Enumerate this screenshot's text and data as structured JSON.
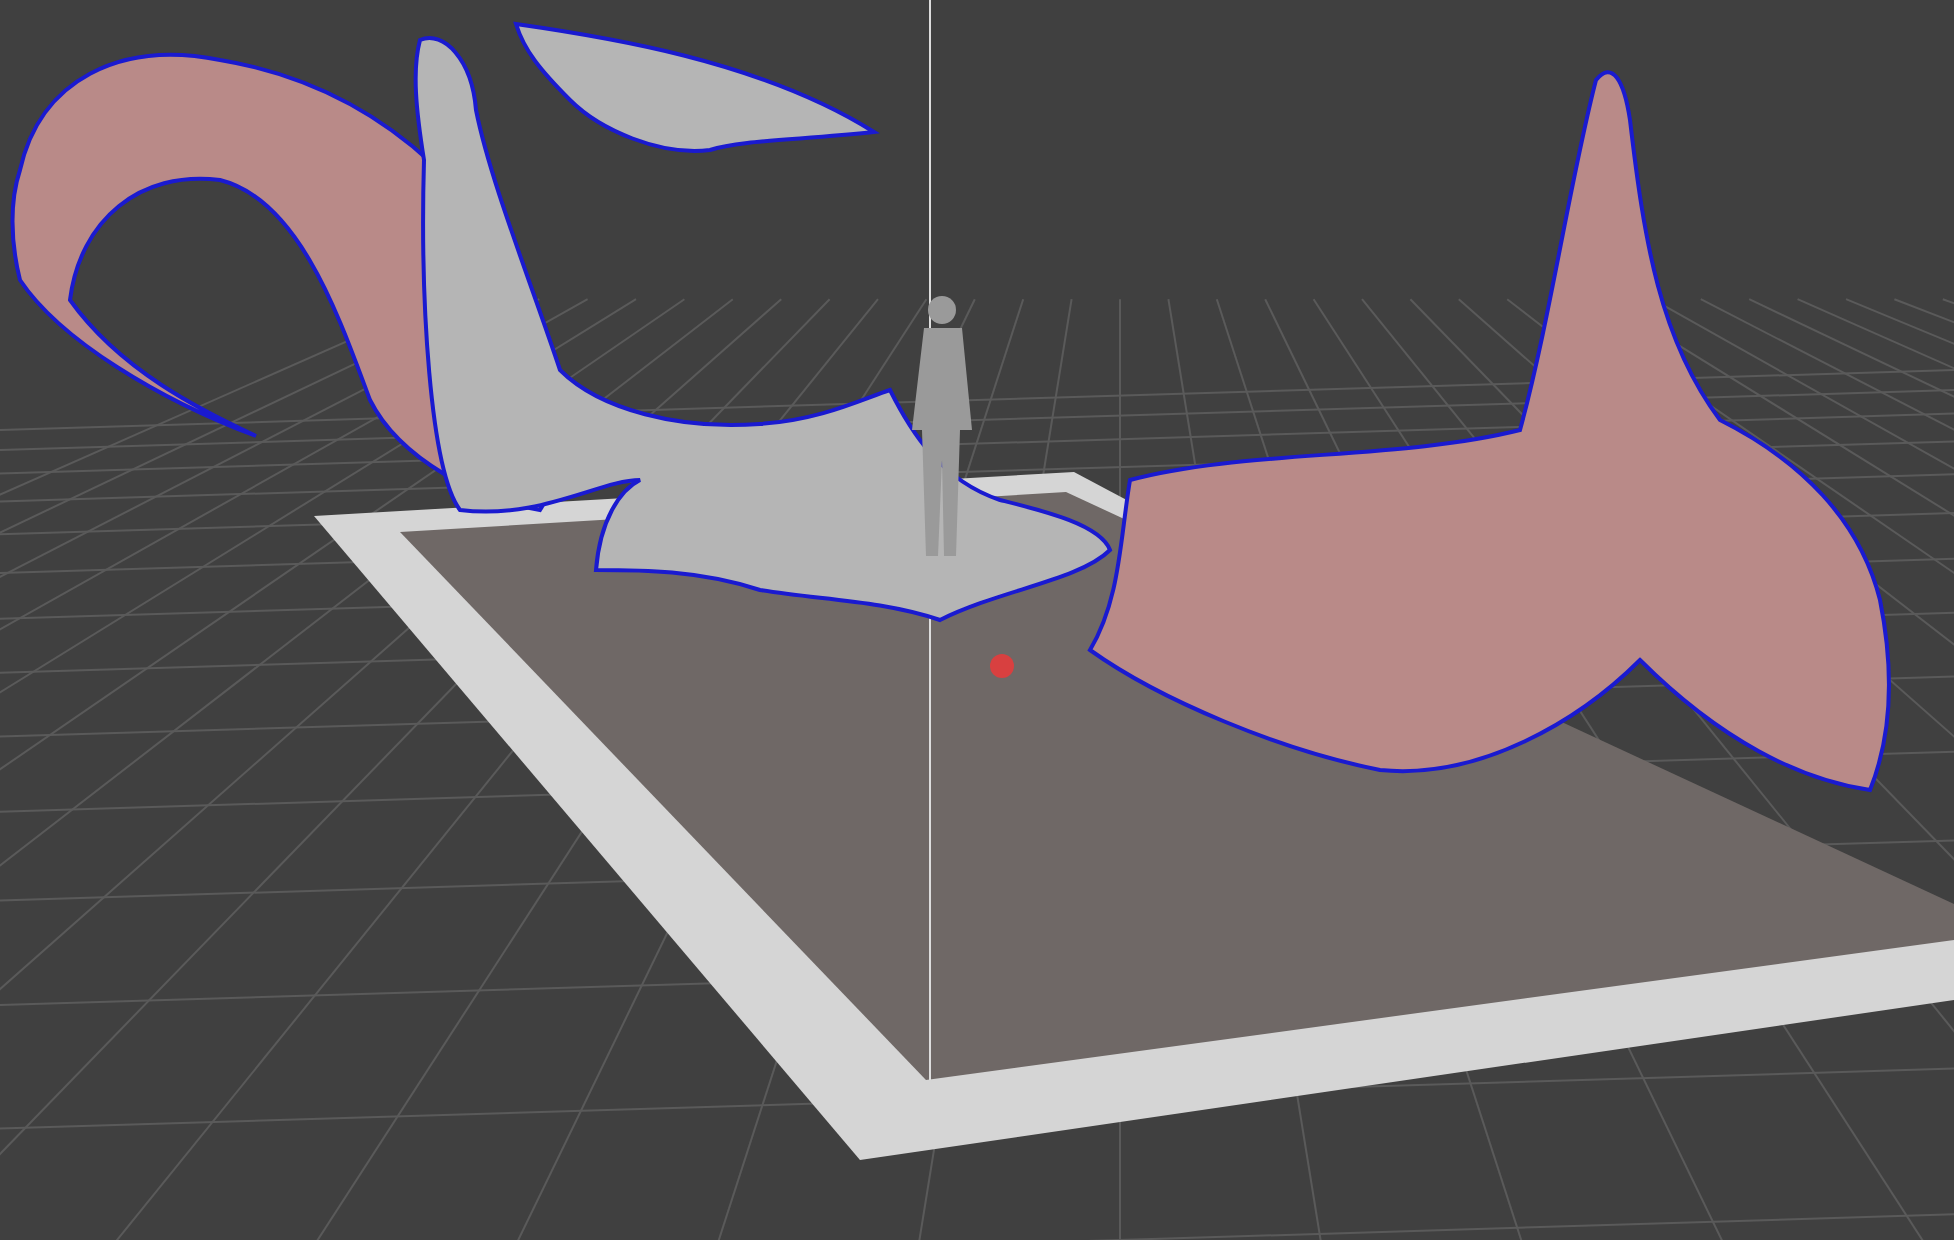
{
  "objects": [
    {
      "kind": "surface",
      "selected": true
    },
    {
      "kind": "surface",
      "selected": true
    },
    {
      "kind": "sculpture",
      "selected": true
    },
    {
      "kind": "sculpture",
      "selected": true
    },
    {
      "kind": "figure",
      "selected": false
    },
    {
      "kind": "marker",
      "selected": false
    }
  ]
}
